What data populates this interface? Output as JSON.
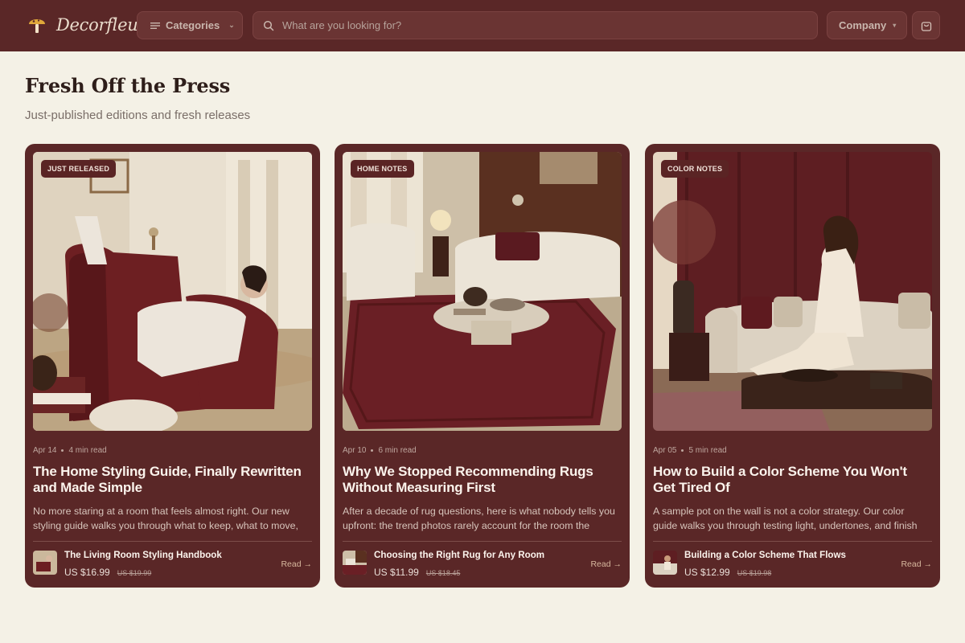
{
  "header": {
    "brand": "Decorfleur",
    "categories_label": "Categories",
    "search_placeholder": "What are you looking for?",
    "company_label": "Company"
  },
  "section": {
    "title": "Fresh Off the Press",
    "subtitle": "Just-published editions and fresh releases"
  },
  "cards": [
    {
      "badge": "JUST RELEASED",
      "date": "Apr 14",
      "read_time": "4 min read",
      "title": "The Home Styling Guide, Finally Rewritten and Made Simple",
      "description": "No more staring at a room that feels almost right. Our new styling guide walks you through what to keep, what to move,",
      "book_title": "The Living Room Styling Handbook",
      "price": "US $16.99",
      "old_price": "US $19.99",
      "read_label": "Read →"
    },
    {
      "badge": "HOME NOTES",
      "date": "Apr 10",
      "read_time": "6 min read",
      "title": "Why We Stopped Recommending Rugs Without Measuring First",
      "description": "After a decade of rug questions, here is what nobody tells you upfront: the trend photos rarely account for the room the",
      "book_title": "Choosing the Right Rug for Any Room",
      "price": "US $11.99",
      "old_price": "US $18.45",
      "read_label": "Read →"
    },
    {
      "badge": "COLOR NOTES",
      "date": "Apr 05",
      "read_time": "5 min read",
      "title": "How to Build a Color Scheme You Won't Get Tired Of",
      "description": "A sample pot on the wall is not a color strategy. Our color guide walks you through testing light, undertones, and finish",
      "book_title": "Building a Color Scheme That Flows",
      "price": "US $12.99",
      "old_price": "US $19.98",
      "read_label": "Read →"
    }
  ]
}
